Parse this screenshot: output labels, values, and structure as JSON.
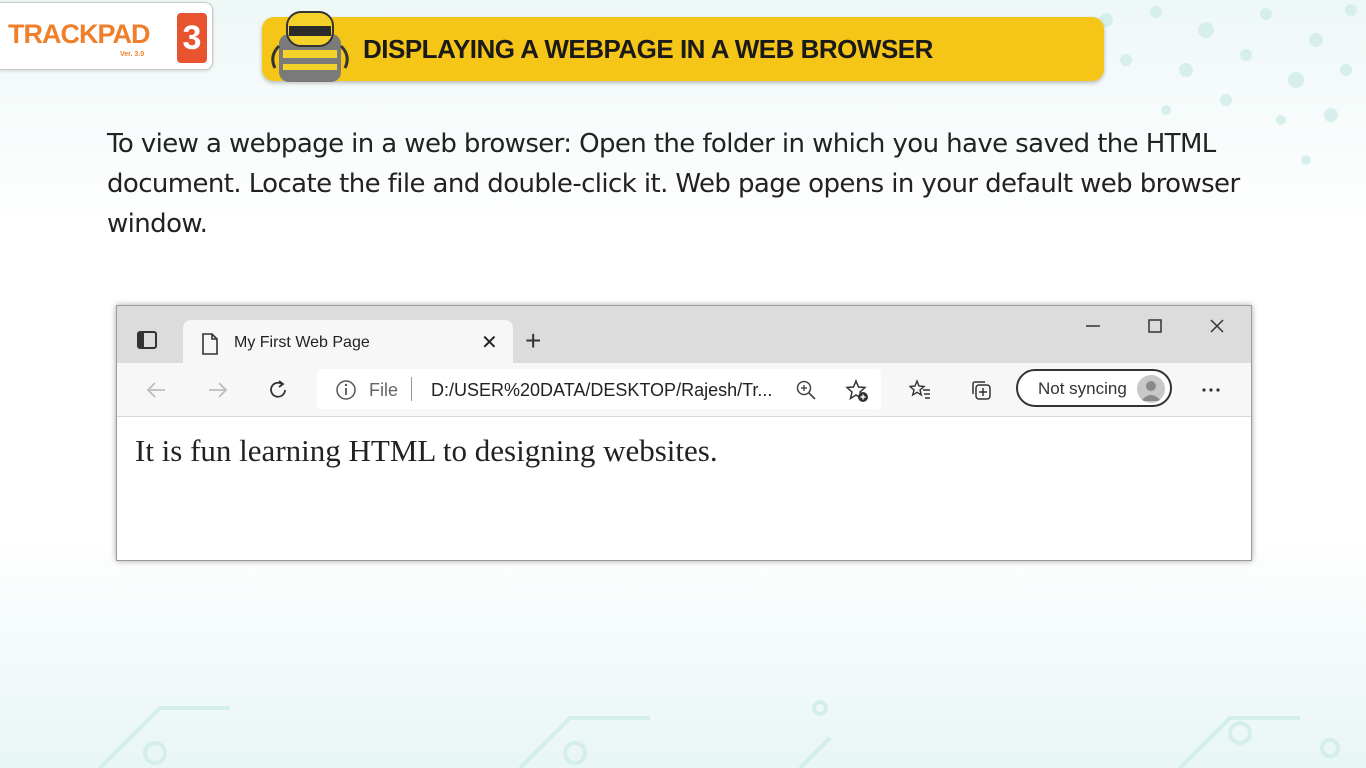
{
  "logo": {
    "text": "TRACKPAD",
    "version": "Ver. 3.0",
    "badge": "3"
  },
  "banner": {
    "title": "DISPLAYING A WEBPAGE IN A WEB BROWSER"
  },
  "intro": {
    "text": "To view a webpage in a web browser: Open the folder in which you have saved the HTML document. Locate the file and double-click it. Web page opens in your default web browser window."
  },
  "browser": {
    "tab_title": "My First Web Page",
    "address_scheme": "File",
    "address_url": "D:/USER%20DATA/DESKTOP/Rajesh/Tr...",
    "sync_label": "Not syncing",
    "page_text": "It is fun learning HTML to designing websites."
  },
  "colors": {
    "banner": "#f5c518",
    "logo_orange": "#ef7f2a",
    "logo_badge": "#e8542f"
  },
  "icons": [
    "tab-actions-icon",
    "page-icon",
    "close-icon",
    "plus-icon",
    "minimize-icon",
    "maximize-icon",
    "window-close-icon",
    "back-arrow-icon",
    "forward-arrow-icon",
    "refresh-icon",
    "info-icon",
    "zoom-icon",
    "add-favorite-icon",
    "favorites-icon",
    "collections-icon",
    "profile-icon",
    "more-icon",
    "backpack-icon"
  ]
}
